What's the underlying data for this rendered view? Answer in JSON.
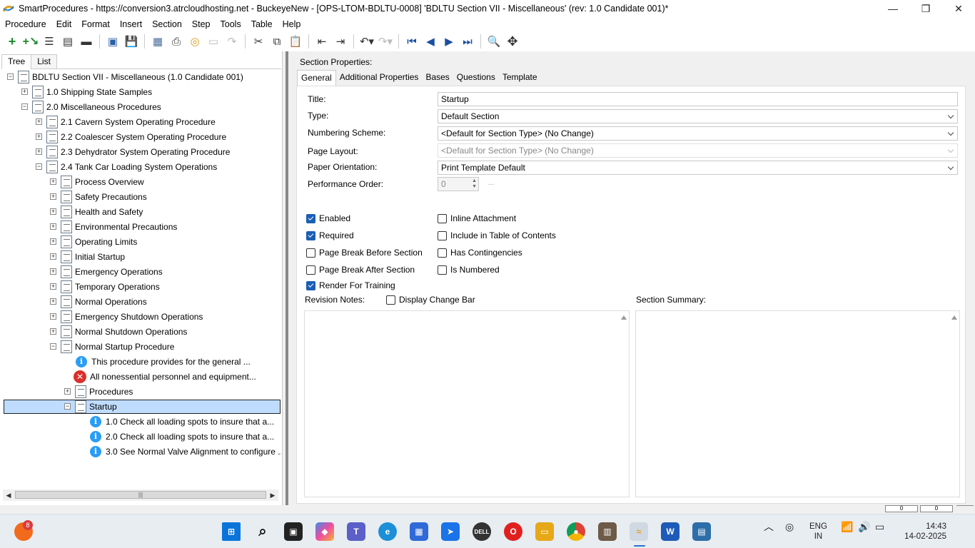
{
  "window": {
    "title": "SmartProcedures - https://conversion3.atrcloudhosting.net - BuckeyeNew - [OPS-LTOM-BDLTU-0008] 'BDLTU Section VII - Miscellaneous' (rev: 1.0 Candidate 001)*",
    "minimize": "—",
    "maximize": "❐",
    "close": "✕"
  },
  "menu": [
    "Procedure",
    "Edit",
    "Format",
    "Insert",
    "Section",
    "Step",
    "Tools",
    "Table",
    "Help"
  ],
  "left_tabs": [
    "Tree",
    "List"
  ],
  "tree": [
    {
      "label": "BDLTU Section VII - Miscellaneous (1.0 Candidate 001)",
      "exp": "−",
      "icon": "doc"
    },
    {
      "label": "1.0 Shipping State Samples",
      "exp": "+",
      "icon": "doc"
    },
    {
      "label": "2.0 Miscellaneous Procedures",
      "exp": "−",
      "icon": "doc"
    },
    {
      "label": "2.1 Cavern System Operating Procedure",
      "exp": "+",
      "icon": "doc"
    },
    {
      "label": "2.2 Coalescer System Operating Procedure",
      "exp": "+",
      "icon": "doc"
    },
    {
      "label": "2.3 Dehydrator System Operating Procedure",
      "exp": "+",
      "icon": "doc"
    },
    {
      "label": "2.4 Tank Car Loading System Operations",
      "exp": "−",
      "icon": "doc"
    },
    {
      "label": "Process Overview",
      "exp": "+",
      "icon": "doc"
    },
    {
      "label": "Safety Precautions",
      "exp": "+",
      "icon": "doc"
    },
    {
      "label": "Health and Safety",
      "exp": "+",
      "icon": "doc"
    },
    {
      "label": "Environmental Precautions",
      "exp": "+",
      "icon": "doc"
    },
    {
      "label": "Operating Limits",
      "exp": "+",
      "icon": "doc"
    },
    {
      "label": "Initial Startup",
      "exp": "+",
      "icon": "doc"
    },
    {
      "label": "Emergency Operations",
      "exp": "+",
      "icon": "doc"
    },
    {
      "label": "Temporary Operations",
      "exp": "+",
      "icon": "doc"
    },
    {
      "label": "Normal Operations",
      "exp": "+",
      "icon": "doc"
    },
    {
      "label": "Emergency Shutdown Operations",
      "exp": "+",
      "icon": "doc"
    },
    {
      "label": "Normal Shutdown Operations",
      "exp": "+",
      "icon": "doc"
    },
    {
      "label": "Normal Startup Procedure",
      "exp": "−",
      "icon": "doc"
    },
    {
      "label": "This procedure provides for the general ...",
      "exp": "",
      "icon": "info"
    },
    {
      "label": "All nonessential personnel and equipment...",
      "exp": "",
      "icon": "error"
    },
    {
      "label": "Procedures",
      "exp": "+",
      "icon": "doc"
    },
    {
      "label": "Startup",
      "exp": "−",
      "icon": "doc"
    },
    {
      "label": "1.0 Check all loading spots to insure that a...",
      "exp": "",
      "icon": "info"
    },
    {
      "label": "2.0 Check all loading spots to insure that a...",
      "exp": "",
      "icon": "info"
    },
    {
      "label": "3.0 See Normal Valve Alignment to configure ...",
      "exp": "",
      "icon": "info"
    }
  ],
  "section": {
    "header": "Section Properties:",
    "tabs": [
      "General",
      "Additional Properties",
      "Bases",
      "Questions",
      "Template"
    ],
    "fields": {
      "title_label": "Title:",
      "title_value": "Startup",
      "type_label": "Type:",
      "type_value": "Default Section",
      "numbering_label": "Numbering Scheme:",
      "numbering_value": "<Default for Section Type> (No Change)",
      "layout_label": "Page Layout:",
      "layout_value": "<Default for Section Type> (No Change)",
      "orientation_label": "Paper Orientation:",
      "orientation_value": "Print Template Default",
      "perf_label": "Performance Order:",
      "perf_value": "0",
      "ellipsis": "..."
    },
    "checkboxes": [
      {
        "label": "Enabled",
        "checked": true
      },
      {
        "label": "Required",
        "checked": true
      },
      {
        "label": "Page Break Before Section",
        "checked": false
      },
      {
        "label": "Page Break After Section",
        "checked": false
      },
      {
        "label": "Render For Training",
        "checked": true
      },
      {
        "label": "Inline Attachment",
        "checked": false
      },
      {
        "label": "Include in Table of Contents",
        "checked": false
      },
      {
        "label": "Has Contingencies",
        "checked": false
      },
      {
        "label": "Is Numbered",
        "checked": false
      }
    ],
    "revision_notes_label": "Revision Notes:",
    "display_change_bar": "Display Change Bar",
    "summary_label": "Section Summary:"
  },
  "statusbar": {
    "pane1": "0",
    "pane2": "0"
  },
  "taskbar": {
    "notification_count": "8",
    "lang": "ENG",
    "region": "IN",
    "time": "14:43",
    "date": "14-02-2025"
  },
  "colors": {
    "selection": "#bfdcff",
    "checkbox": "#1a5fb4",
    "info": "#2a9df4",
    "error": "#d9302c"
  }
}
